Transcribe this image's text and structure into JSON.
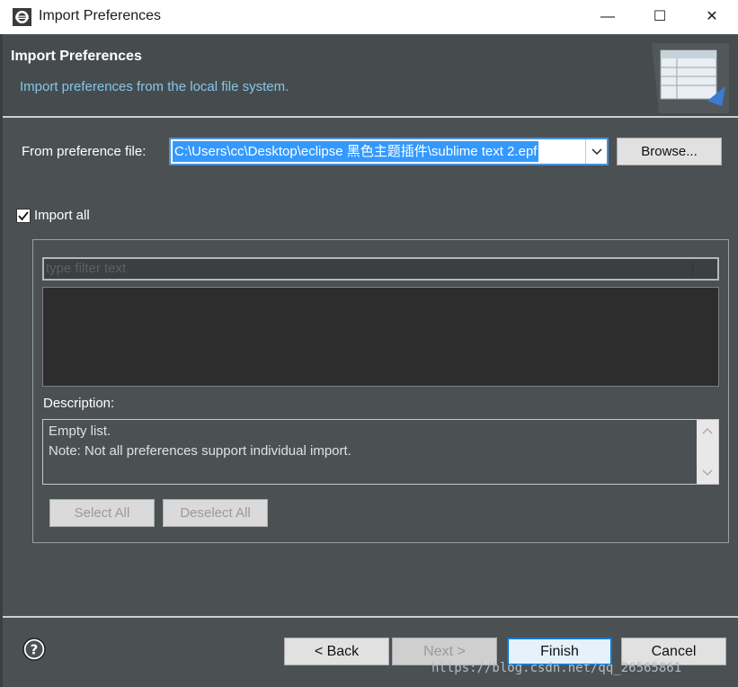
{
  "window": {
    "title": "Import Preferences",
    "minimize_glyph": "—",
    "maximize_glyph": "☐",
    "close_glyph": "✕"
  },
  "header": {
    "title": "Import Preferences",
    "description": "Import preferences from the local file system."
  },
  "file_row": {
    "label": "From preference file:",
    "value": "C:\\Users\\cc\\Desktop\\eclipse 黑色主题插件\\sublime text 2.epf",
    "browse_label": "Browse..."
  },
  "import_all": {
    "label": "Import all",
    "checked": true
  },
  "filter": {
    "placeholder": "type filter text"
  },
  "description": {
    "label": "Description:",
    "line1": "Empty list.",
    "line2": "Note: Not all preferences support individual import."
  },
  "buttons": {
    "select_all": "Select All",
    "deselect_all": "Deselect All",
    "back": "< Back",
    "next": "Next >",
    "finish": "Finish",
    "cancel": "Cancel"
  },
  "watermark": "https://blog.csdn.net/qq_26565861",
  "colors": {
    "background": "#4b5153",
    "accent": "#0078d7",
    "description_text": "#86c6ea",
    "selection": "#3399ff"
  }
}
